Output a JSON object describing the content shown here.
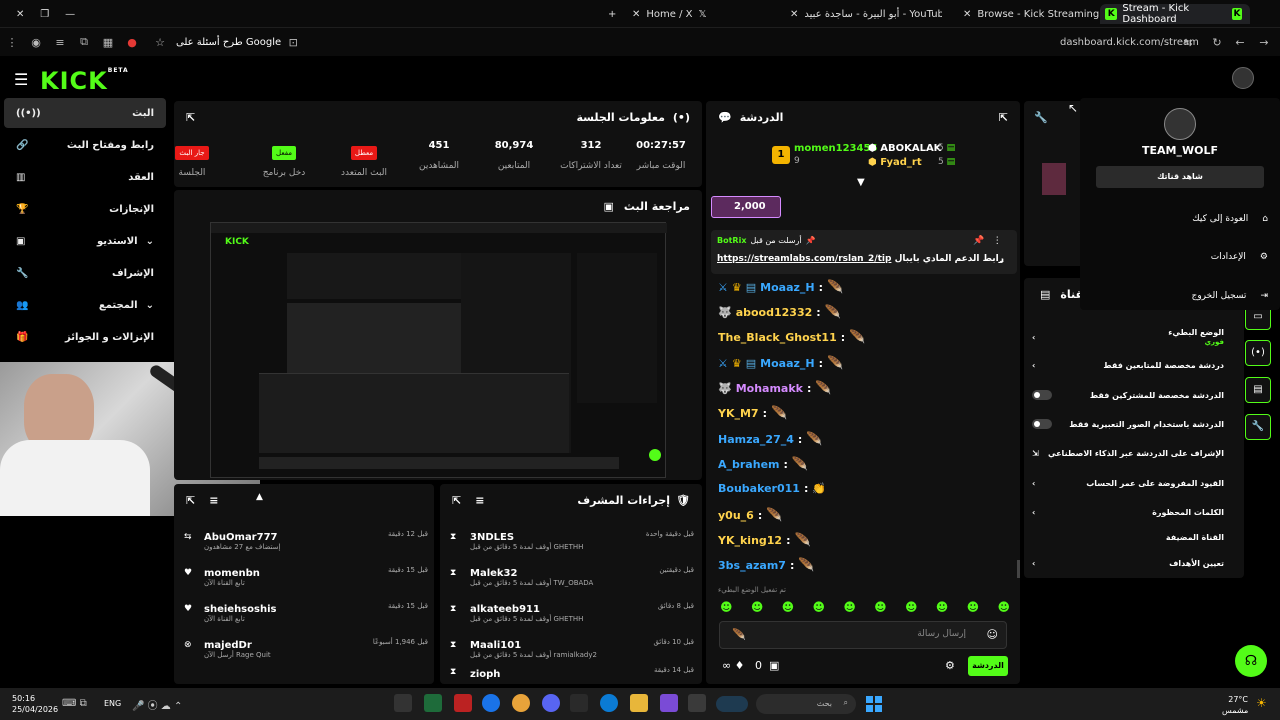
{
  "tabs": [
    {
      "title": "Stream - Kick Dashboard"
    },
    {
      "title": "Browse - Kick Streaming"
    },
    {
      "title": "أبو البيرة - ساجدة عبيد - YouTube"
    },
    {
      "title": "Home / X"
    }
  ],
  "address": {
    "url": "dashboard.kick.com/stream",
    "search": "طرح أسئلة على Google"
  },
  "logo": "KICK",
  "logo_badge": "BETA",
  "sidebar": {
    "items": [
      {
        "label": "البث"
      },
      {
        "label": "رابط ومفتاح البث"
      },
      {
        "label": "العقد"
      },
      {
        "label": "الإنجازات"
      },
      {
        "label": "الاستديو"
      },
      {
        "label": "الإشراف"
      },
      {
        "label": "المجتمع"
      },
      {
        "label": "الإنزالات و الجوائز"
      }
    ]
  },
  "session": {
    "title": "معلومات الجلسة",
    "stats": [
      {
        "value": "00:27:57",
        "label": "الوقت مباشر"
      },
      {
        "value": "312",
        "label": "تعداد الاشتراكات"
      },
      {
        "value": "80,974",
        "label": "المتابعين"
      },
      {
        "value": "451",
        "label": "المشاهدين"
      },
      {
        "badge": "معطل",
        "label": "البث المتعدد"
      },
      {
        "badge": "مفعل",
        "label": "دخل برنامج"
      },
      {
        "badge": "جار البث",
        "label": "الجلسة"
      }
    ]
  },
  "preview": {
    "title": "مراجعة البث"
  },
  "chat": {
    "title": "الدردشة",
    "top": [
      {
        "name": "momen123456",
        "count": "9"
      },
      {
        "name": "ABOKALAK",
        "count": "5"
      },
      {
        "name": "Fyad_rt",
        "count": "5"
      }
    ],
    "goal": "2,000",
    "pinned": {
      "by": "BotRix",
      "header": "أرسلت من قبل",
      "text": "رابط الدعم المادي بايبال",
      "link": "https://streamlabs.com/rslan_2/tip"
    },
    "messages": [
      {
        "user": "Moaaz_H",
        "color": "#3aa8ff"
      },
      {
        "user": "abood12332",
        "color": "#ffd34d"
      },
      {
        "user": "The_Black_Ghost11",
        "color": "#ffd34d"
      },
      {
        "user": "Moaaz_H",
        "color": "#3aa8ff"
      },
      {
        "user": "Mohamakk",
        "color": "#d58bff"
      },
      {
        "user": "YK_M7",
        "color": "#ffd34d"
      },
      {
        "user": "Hamza_27_4",
        "color": "#3aa8ff"
      },
      {
        "user": "A_brahem",
        "color": "#3aa8ff"
      },
      {
        "user": "Boubaker011",
        "color": "#3aa8ff"
      },
      {
        "user": "y0u_6",
        "color": "#ffd34d"
      },
      {
        "user": "YK_king12",
        "color": "#ffd34d"
      },
      {
        "user": "3bs_azam7",
        "color": "#3aa8ff"
      }
    ],
    "slow_mode": "تم تفعيل الوضع البطيء",
    "placeholder": "إرسال رسالة",
    "send": "الدردشة",
    "count": "0"
  },
  "feed": {
    "rows": [
      {
        "name": "AbuOmar777",
        "sub": "إستضاف مع 27 مشاهدون",
        "time": "قبل 12 دقيقة"
      },
      {
        "name": "momenbn",
        "sub": "تابع القناة الآن",
        "time": "قبل 15 دقيقة"
      },
      {
        "name": "sheiehsoshis",
        "sub": "تابع القناة الآن",
        "time": "قبل 15 دقيقة"
      },
      {
        "name": "majedDr",
        "sub": "أرسل الآن Rage Quit",
        "time": "قبل 1,946 أسبوعًا"
      }
    ]
  },
  "modactions": {
    "title": "إجراءات المشرف",
    "rows": [
      {
        "name": "3NDLES",
        "sub": "أوقف لمدة 5 دقائق من قبل GHETHH",
        "time": "قبل دقيقة واحدة"
      },
      {
        "name": "Malek32",
        "sub": "أوقف لمدة 5 دقائق من قبل TW_OBADA",
        "time": "قبل دقيقتين"
      },
      {
        "name": "alkateeb911",
        "sub": "أوقف لمدة 5 دقائق من قبل GHETHH",
        "time": "قبل 8 دقائق"
      },
      {
        "name": "Maali101",
        "sub": "أوقف لمدة 5 دقائق من قبل ramialkady2",
        "time": "قبل 10 دقائق"
      },
      {
        "name": "zioph",
        "sub": "",
        "time": "قبل 14 دقيقة"
      }
    ]
  },
  "channel": {
    "title": "القناة",
    "options": [
      {
        "label": "الوضع البطيء",
        "sub": "فوري",
        "type": "chev"
      },
      {
        "label": "دردشة مخصصة للمتابعين فقط",
        "type": "chev"
      },
      {
        "label": "الدردشة مخصصة للمشتركين فقط",
        "type": "toggle"
      },
      {
        "label": "الدردشة باستخدام الصور التعبيرية فقط",
        "type": "toggle"
      },
      {
        "label": "الإشراف على الدردشة عبر الذكاء الاصطناعي",
        "type": "ext"
      },
      {
        "label": "القيود المفروضة على عمر الحساب",
        "type": "chev"
      },
      {
        "label": "الكلمات المحظورة",
        "type": "chev"
      },
      {
        "label": "القناة المضيفة",
        "type": "none"
      },
      {
        "label": "تعيين الأهداف",
        "type": "chev"
      }
    ]
  },
  "menu": {
    "username": "TEAM_WOLF",
    "view": "شاهد قناتك",
    "items": [
      {
        "label": "العودة إلى كيك"
      },
      {
        "label": "الإعدادات"
      },
      {
        "label": "تسجيل الخروج"
      }
    ]
  },
  "taskbar": {
    "time": "50:16",
    "date": "25/04/2026",
    "lang": "ENG",
    "temp": "27°C",
    "weather": "مشمس",
    "search": "بحث"
  }
}
